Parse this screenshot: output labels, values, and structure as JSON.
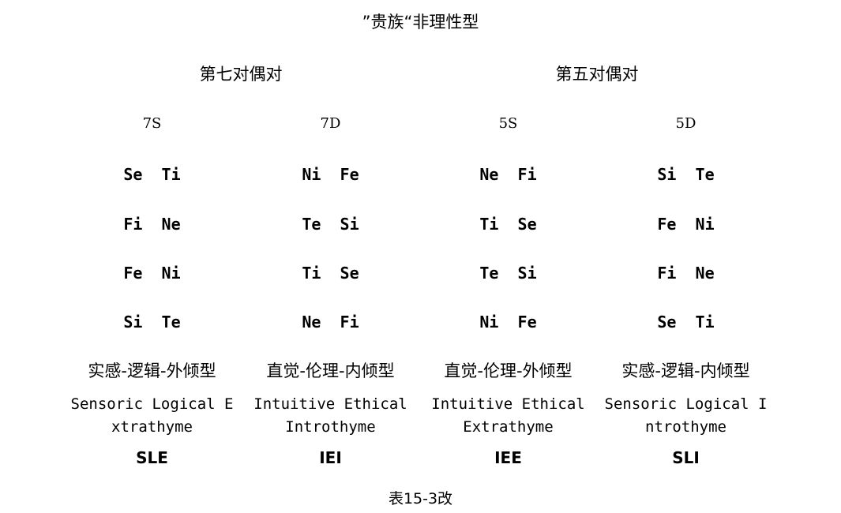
{
  "title": "”贵族“非理性型",
  "groups": [
    {
      "label": "第七对偶对"
    },
    {
      "label": "第五对偶对"
    }
  ],
  "columns": [
    {
      "code": "7S",
      "functions": [
        "Se  Ti",
        "Fi  Ne",
        "Fe  Ni",
        "Si  Te"
      ],
      "name_cn": "实感-逻辑-外倾型",
      "name_en": "Sensoric Logical Extrathyme",
      "abbr": "SLE"
    },
    {
      "code": "7D",
      "functions": [
        "Ni  Fe",
        "Te  Si",
        "Ti  Se",
        "Ne  Fi"
      ],
      "name_cn": "直觉-伦理-内倾型",
      "name_en": "Intuitive Ethical Introthyme",
      "abbr": "IEI"
    },
    {
      "code": "5S",
      "functions": [
        "Ne  Fi",
        "Ti  Se",
        "Te  Si",
        "Ni  Fe"
      ],
      "name_cn": "直觉-伦理-外倾型",
      "name_en": "Intuitive Ethical Extrathyme",
      "abbr": "IEE"
    },
    {
      "code": "5D",
      "functions": [
        "Si  Te",
        "Fe  Ni",
        "Fi  Ne",
        "Se  Ti"
      ],
      "name_cn": "实感-逻辑-内倾型",
      "name_en": "Sensoric Logical Introthyme",
      "abbr": "SLI"
    }
  ],
  "caption": "表15-3改"
}
